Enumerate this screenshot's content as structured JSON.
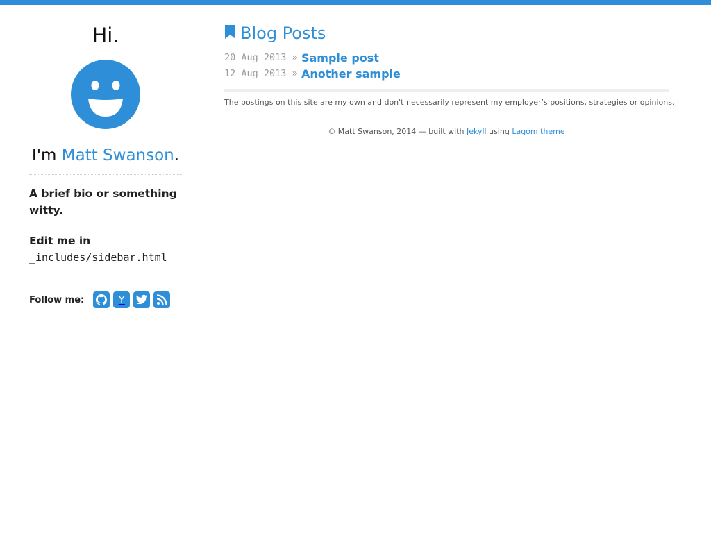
{
  "colors": {
    "accent": "#2e8fd8",
    "text": "#222222",
    "muted": "#9a9a9a"
  },
  "sidebar": {
    "greeting": "Hi.",
    "avatar_icon": "smiley-face-icon",
    "intro_prefix": "I'm ",
    "author_name": "Matt Swanson",
    "intro_suffix": ".",
    "bio": "A brief bio or something witty.",
    "edit_prefix": "Edit me in",
    "edit_path": "_includes/sidebar.html",
    "follow_label": "Follow me:",
    "social": [
      {
        "name": "github",
        "icon": "github-icon"
      },
      {
        "name": "hacker-news",
        "icon": "hacker-news-icon",
        "glyph": "Y"
      },
      {
        "name": "twitter",
        "icon": "twitter-icon"
      },
      {
        "name": "rss",
        "icon": "rss-icon"
      }
    ]
  },
  "main": {
    "heading_icon": "bookmark-icon",
    "heading": "Blog Posts",
    "separator": "»",
    "posts": [
      {
        "date": "20 Aug 2013",
        "title": "Sample post"
      },
      {
        "date": "12 Aug 2013",
        "title": "Another sample"
      }
    ],
    "disclaimer": "The postings on this site are my own and don't necessarily represent my employer’s positions, strategies or opinions.",
    "footer": {
      "copyright": "© Matt Swanson, 2014 — built with ",
      "jekyll": "Jekyll",
      "using": " using ",
      "theme": "Lagom theme"
    }
  }
}
